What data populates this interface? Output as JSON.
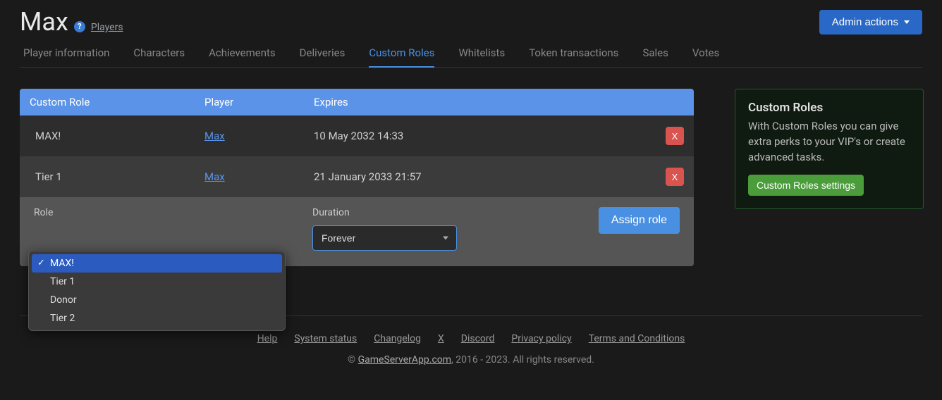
{
  "header": {
    "title": "Max",
    "breadcrumb": "Players",
    "admin_button": "Admin actions"
  },
  "tabs": [
    {
      "label": "Player information",
      "active": false
    },
    {
      "label": "Characters",
      "active": false
    },
    {
      "label": "Achievements",
      "active": false
    },
    {
      "label": "Deliveries",
      "active": false
    },
    {
      "label": "Custom Roles",
      "active": true
    },
    {
      "label": "Whitelists",
      "active": false
    },
    {
      "label": "Token transactions",
      "active": false
    },
    {
      "label": "Sales",
      "active": false
    },
    {
      "label": "Votes",
      "active": false
    }
  ],
  "table": {
    "headers": {
      "role": "Custom Role",
      "player": "Player",
      "expires": "Expires"
    },
    "rows": [
      {
        "role": "MAX!",
        "player": "Max",
        "expires": "10 May 2032 14:33",
        "del": "X"
      },
      {
        "role": "Tier 1",
        "player": "Max",
        "expires": "21 January 2033 21:57",
        "del": "X"
      }
    ]
  },
  "form": {
    "role_label": "Role",
    "duration_label": "Duration",
    "duration_value": "Forever",
    "assign_label": "Assign role",
    "role_options": [
      {
        "label": "MAX!",
        "selected": true
      },
      {
        "label": "Tier 1",
        "selected": false
      },
      {
        "label": "Donor",
        "selected": false
      },
      {
        "label": "Tier 2",
        "selected": false
      }
    ]
  },
  "sidebar": {
    "title": "Custom Roles",
    "text": "With Custom Roles you can give extra perks to your VIP's or create advanced tasks.",
    "button": "Custom Roles settings"
  },
  "footer": {
    "links": [
      "Help",
      "System status",
      "Changelog",
      "X",
      "Discord",
      "Privacy policy",
      "Terms and Conditions"
    ],
    "copyright_prefix": "© ",
    "copyright_link": "GameServerApp.com",
    "copyright_suffix": ", 2016 - 2023. All rights reserved."
  }
}
